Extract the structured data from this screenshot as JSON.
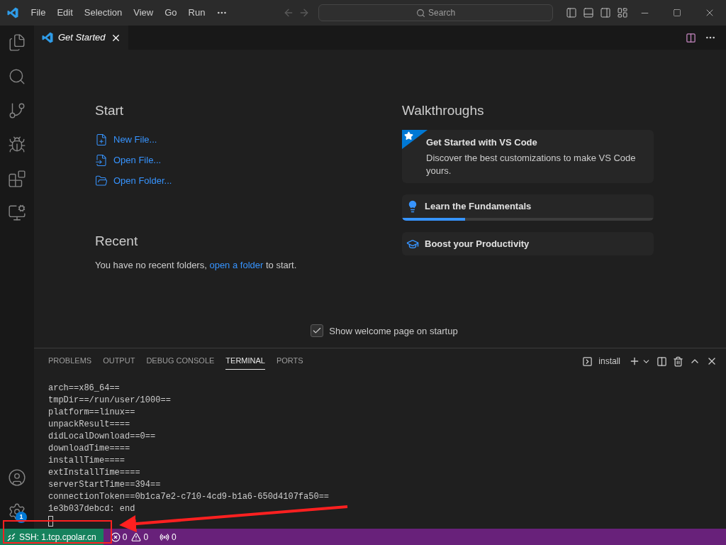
{
  "menu": [
    "File",
    "Edit",
    "Selection",
    "View",
    "Go",
    "Run"
  ],
  "search": {
    "placeholder": "Search"
  },
  "editor_tabs": [
    {
      "label": "Get Started",
      "selected": true
    }
  ],
  "activity_bar": {
    "top": [
      {
        "kind": "explorer"
      },
      {
        "kind": "search"
      },
      {
        "kind": "source-control"
      },
      {
        "kind": "run-debug"
      },
      {
        "kind": "extensions"
      },
      {
        "kind": "remote"
      }
    ],
    "bottom": [
      {
        "kind": "accounts"
      },
      {
        "kind": "manage",
        "badge": "1"
      }
    ]
  },
  "start": {
    "title": "Start",
    "items": [
      {
        "kind": "new-file",
        "label": "New File..."
      },
      {
        "kind": "open-file",
        "label": "Open File..."
      },
      {
        "kind": "open-folder",
        "label": "Open Folder..."
      }
    ]
  },
  "recent": {
    "title": "Recent",
    "before": "You have no recent folders, ",
    "link": "open a folder",
    "after": " to start."
  },
  "walkthroughs": {
    "title": "Walkthroughs",
    "items": [
      {
        "kind": "featured",
        "title": "Get Started with VS Code",
        "description": "Discover the best customizations to make VS Code yours."
      },
      {
        "kind": "bulb",
        "title": "Learn the Fundamentals",
        "level": 0.25
      },
      {
        "kind": "cap",
        "title": "Boost your Productivity"
      }
    ]
  },
  "show_welcome": {
    "label": "Show welcome page on startup",
    "checked": true
  },
  "panel_tabs": [
    {
      "label": "PROBLEMS",
      "selected": false
    },
    {
      "label": "OUTPUT",
      "selected": false
    },
    {
      "label": "DEBUG CONSOLE",
      "selected": false
    },
    {
      "label": "TERMINAL",
      "selected": true
    },
    {
      "label": "PORTS",
      "selected": false
    }
  ],
  "terminal": {
    "name": "install",
    "lines": [
      "arch==x86_64==",
      "tmpDir==/run/user/1000==",
      "platform==linux==",
      "unpackResult====",
      "didLocalDownload==0==",
      "downloadTime====",
      "installTime====",
      "extInstallTime====",
      "serverStartTime==394==",
      "connectionToken==0b1ca7e2-c710-4cd9-b1a6-650d4107fa50==",
      "1e3b037debcd: end"
    ]
  },
  "status_bar": {
    "remote": "SSH: 1.tcp.cpolar.cn",
    "errors": "0",
    "warnings": "0",
    "ports": "0"
  }
}
